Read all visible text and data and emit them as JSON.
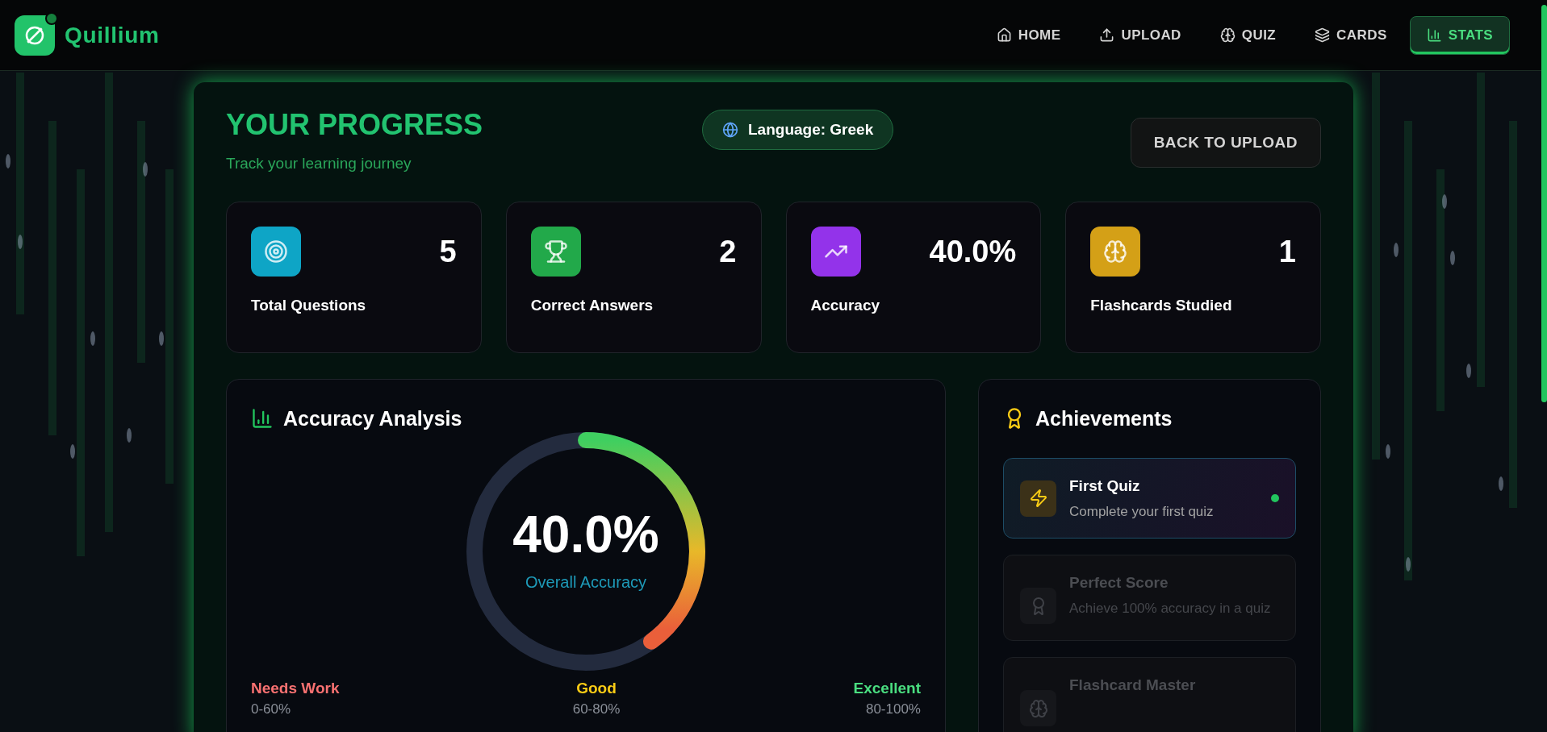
{
  "app": {
    "name": "Quillium"
  },
  "nav": [
    {
      "label": "HOME",
      "kind": "home",
      "selected": false
    },
    {
      "label": "UPLOAD",
      "kind": "upload",
      "selected": false
    },
    {
      "label": "QUIZ",
      "kind": "brain",
      "selected": false
    },
    {
      "label": "CARDS",
      "kind": "layers",
      "selected": false
    },
    {
      "label": "STATS",
      "kind": "chart",
      "selected": true
    }
  ],
  "header": {
    "title": "YOUR PROGRESS",
    "subtitle": "Track your learning journey",
    "language": "Language: Greek",
    "back_button": "BACK TO UPLOAD"
  },
  "stats": [
    {
      "value": "5",
      "label": "Total Questions",
      "kind": "target",
      "color": "#0ea5c6"
    },
    {
      "value": "2",
      "label": "Correct Answers",
      "kind": "trophy",
      "color": "#22a94a"
    },
    {
      "value": "40.0%",
      "label": "Accuracy",
      "kind": "trend",
      "color": "#9333ea"
    },
    {
      "value": "1",
      "label": "Flashcards Studied",
      "kind": "brain",
      "color": "#d4a017"
    }
  ],
  "accuracy": {
    "title": "Accuracy Analysis",
    "value": "40.0%",
    "caption": "Overall Accuracy",
    "level": 0.4,
    "bands": [
      {
        "label": "Needs Work",
        "range": "0-60%",
        "color": "#f87171"
      },
      {
        "label": "Good",
        "range": "60-80%",
        "color": "#facc15"
      },
      {
        "label": "Excellent",
        "range": "80-100%",
        "color": "#4ade80"
      }
    ]
  },
  "achievements": {
    "title": "Achievements",
    "items": [
      {
        "title": "First Quiz",
        "description": "Complete your first quiz",
        "kind": "zap",
        "unlocked": true
      },
      {
        "title": "Perfect Score",
        "description": "Achieve 100% accuracy in a quiz",
        "kind": "award",
        "unlocked": false
      },
      {
        "title": "Flashcard Master",
        "kind": "brain",
        "unlocked": false
      }
    ]
  }
}
